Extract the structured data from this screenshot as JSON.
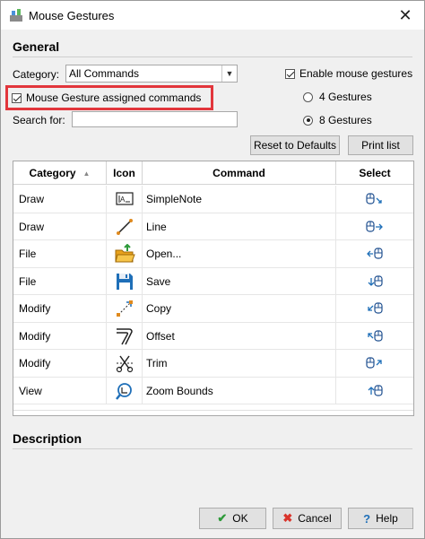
{
  "window": {
    "title": "Mouse Gestures",
    "close_glyph": "✕"
  },
  "general": {
    "heading": "General",
    "category_label": "Category:",
    "category_value": "All Commands",
    "assigned_label": "Mouse Gesture assigned commands",
    "search_label": "Search for:",
    "search_value": "",
    "enable_label": "Enable mouse gestures",
    "gestures_4_label": "4 Gestures",
    "gestures_8_label": "8 Gestures",
    "assigned_checked": true,
    "enable_checked": true,
    "selected_gestures": "8 Gestures"
  },
  "buttons": {
    "reset": "Reset to Defaults",
    "print": "Print list"
  },
  "table": {
    "headers": {
      "category": "Category",
      "icon": "Icon",
      "command": "Command",
      "select": "Select"
    },
    "rows": [
      {
        "category": "Draw",
        "icon": "simplenote-icon",
        "command": "SimpleNote",
        "gesture": "gesture-down-right-icon"
      },
      {
        "category": "Draw",
        "icon": "line-icon",
        "command": "Line",
        "gesture": "gesture-right-icon"
      },
      {
        "category": "File",
        "icon": "open-folder-icon",
        "command": "Open...",
        "gesture": "gesture-left-icon"
      },
      {
        "category": "File",
        "icon": "save-icon",
        "command": "Save",
        "gesture": "gesture-down-left-icon"
      },
      {
        "category": "Modify",
        "icon": "copy-icon",
        "command": "Copy",
        "gesture": "gesture-down-left-icon"
      },
      {
        "category": "Modify",
        "icon": "offset-icon",
        "command": "Offset",
        "gesture": "gesture-up-left-icon"
      },
      {
        "category": "Modify",
        "icon": "trim-icon",
        "command": "Trim",
        "gesture": "gesture-up-right-icon"
      },
      {
        "category": "View",
        "icon": "zoom-bounds-icon",
        "command": "Zoom Bounds",
        "gesture": "gesture-up-left-icon"
      }
    ]
  },
  "description": {
    "heading": "Description"
  },
  "footer": {
    "ok": "OK",
    "cancel": "Cancel",
    "help": "Help",
    "ok_glyph": "✔",
    "cancel_glyph": "✖",
    "help_glyph": "?"
  },
  "colors": {
    "highlight": "#e2363c",
    "ok_green": "#2e9a3a",
    "cancel_red": "#d9342b",
    "icon_blue": "#1f6fb8"
  }
}
